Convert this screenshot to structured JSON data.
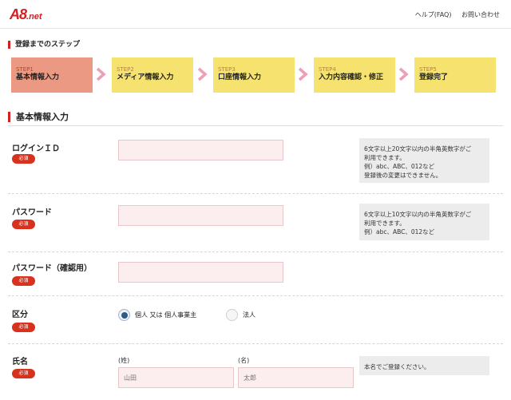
{
  "header": {
    "logo_main": "A8",
    "logo_sub": ".net",
    "links": [
      "ヘルプ(FAQ)",
      "お問い合わせ"
    ]
  },
  "steps_heading": "登録までのステップ",
  "steps": [
    {
      "num": "STEP1",
      "label": "基本情報入力",
      "active": true
    },
    {
      "num": "STEP2",
      "label": "メディア情報入力",
      "active": false
    },
    {
      "num": "STEP3",
      "label": "口座情報入力",
      "active": false
    },
    {
      "num": "STEP4",
      "label": "入力内容確認・修正",
      "active": false
    },
    {
      "num": "STEP5",
      "label": "登録完了",
      "active": false
    }
  ],
  "section_title": "基本情報入力",
  "required_badge": "必須",
  "form": {
    "login_id": {
      "label": "ログインＩＤ",
      "value": "",
      "hint": "6文字以上20文字以内の半角英数字がご\n利用できます。\n例）abc、ABC、012など\n登録後の変更はできません。"
    },
    "password": {
      "label": "パスワード",
      "value": "",
      "hint": "6文字以上10文字以内の半角英数字がご\n利用できます。\n例）abc、ABC、012など"
    },
    "password_confirm": {
      "label": "パスワード（確認用）",
      "value": ""
    },
    "category": {
      "label": "区分",
      "options": [
        "個人 又は 個人事業主",
        "法人"
      ],
      "selected": 0
    },
    "name": {
      "label": "氏名",
      "last_label": "(姓)",
      "first_label": "(名)",
      "last_placeholder": "山田",
      "first_placeholder": "太郎",
      "hint": "本名でご登録ください。"
    }
  },
  "colors": {
    "accent": "#d42020",
    "step_active": "#ec9983",
    "step_inactive": "#f6e36f",
    "arrow": "#ed9fb5",
    "input_bg": "#fcedef"
  }
}
